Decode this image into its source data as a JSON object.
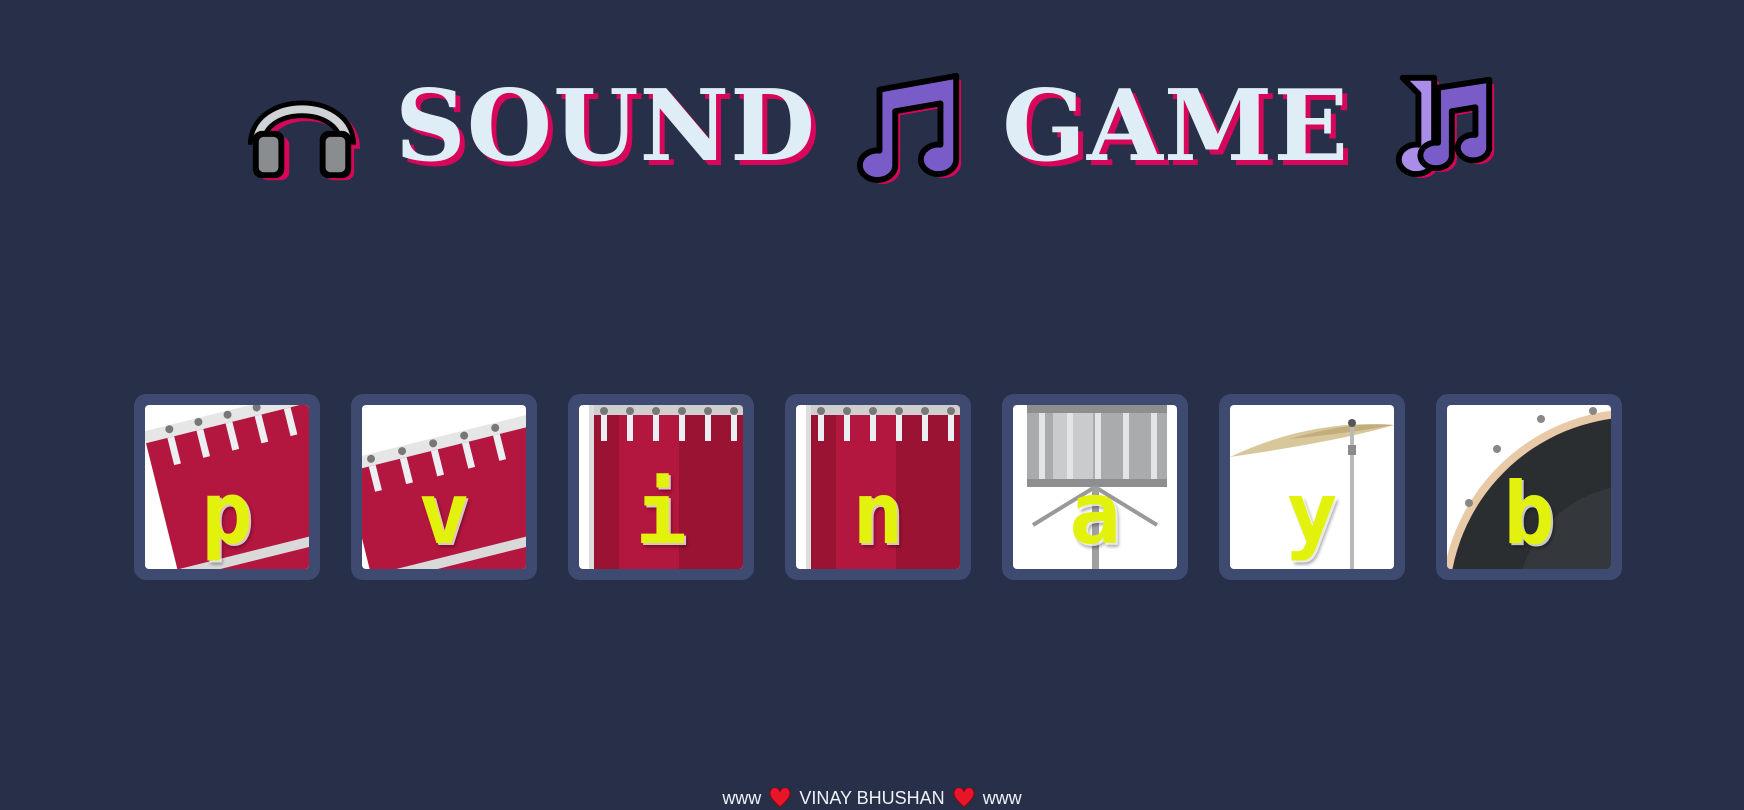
{
  "title": {
    "word1": "SOUND",
    "word2": "GAME",
    "icons": [
      "headphones-icon",
      "musical-note-icon",
      "musical-notes-icon"
    ],
    "text_color": "#dfeef6",
    "shadow_color": "#d8065b"
  },
  "drums": [
    {
      "key": "p",
      "instrument": "tom-tilted-left"
    },
    {
      "key": "v",
      "instrument": "tom-tilted-right"
    },
    {
      "key": "i",
      "instrument": "floor-tom"
    },
    {
      "key": "n",
      "instrument": "floor-tom"
    },
    {
      "key": "a",
      "instrument": "snare"
    },
    {
      "key": "y",
      "instrument": "cymbal"
    },
    {
      "key": "b",
      "instrument": "bass-drum"
    }
  ],
  "footer": {
    "left": "www",
    "name": "VINAY BHUSHAN",
    "right": "www",
    "icon": "heart-icon"
  },
  "colors": {
    "background": "#283049",
    "key_frame": "#3e4a6f",
    "letter": "#e3f20d",
    "drum_red": "#b3163e",
    "heart": "#e8142a"
  }
}
